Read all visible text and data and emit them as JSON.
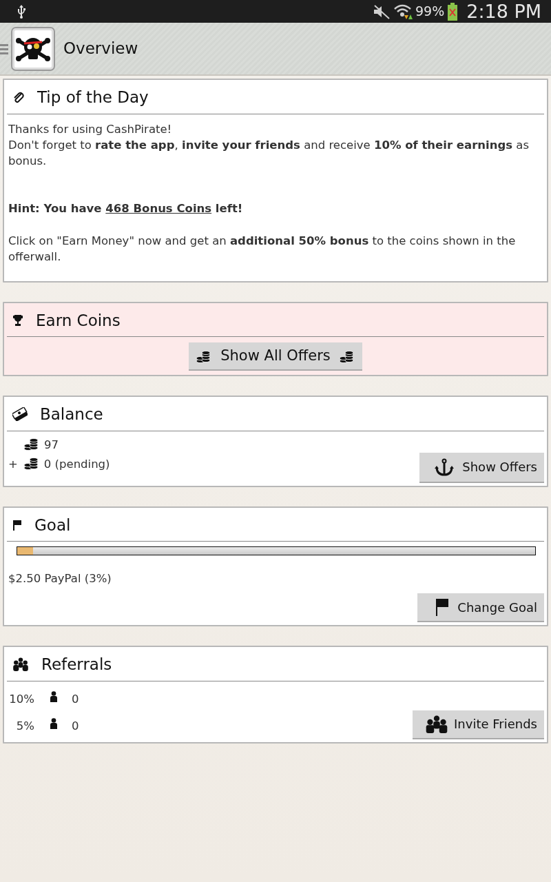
{
  "status_bar": {
    "battery": "99%",
    "time": "2:18 PM"
  },
  "app_bar": {
    "title": "Overview"
  },
  "tip": {
    "title": "Tip of the Day",
    "lines": [
      "Thanks for using CashPirate!",
      "Don't forget to **rate the app**, **invite your friends** and receive **10% of their earnings** as bonus."
    ],
    "hint": {
      "before": "Hint: You have",
      "link": "468 Bonus Coins",
      "after": "left!"
    },
    "note": "Click on \"Earn Money\" now and get an **additional 50% bonus** to the coins shown in the offerwall."
  },
  "earn": {
    "title": "Earn Coins",
    "button": "Show All Offers"
  },
  "balance": {
    "title": "Balance",
    "coins": "97",
    "pending_sign": "+",
    "pending": "0 (pending)",
    "button": "Show Offers"
  },
  "goal": {
    "title": "Goal",
    "level": 0.03,
    "label": "$2.50 PayPal (3%)",
    "button": "Change Goal"
  },
  "referrals": {
    "title": "Referrals",
    "rows": [
      {
        "percent": "10%",
        "count": "0"
      },
      {
        "percent": "5%",
        "count": "0"
      }
    ],
    "button": "Invite Friends"
  }
}
